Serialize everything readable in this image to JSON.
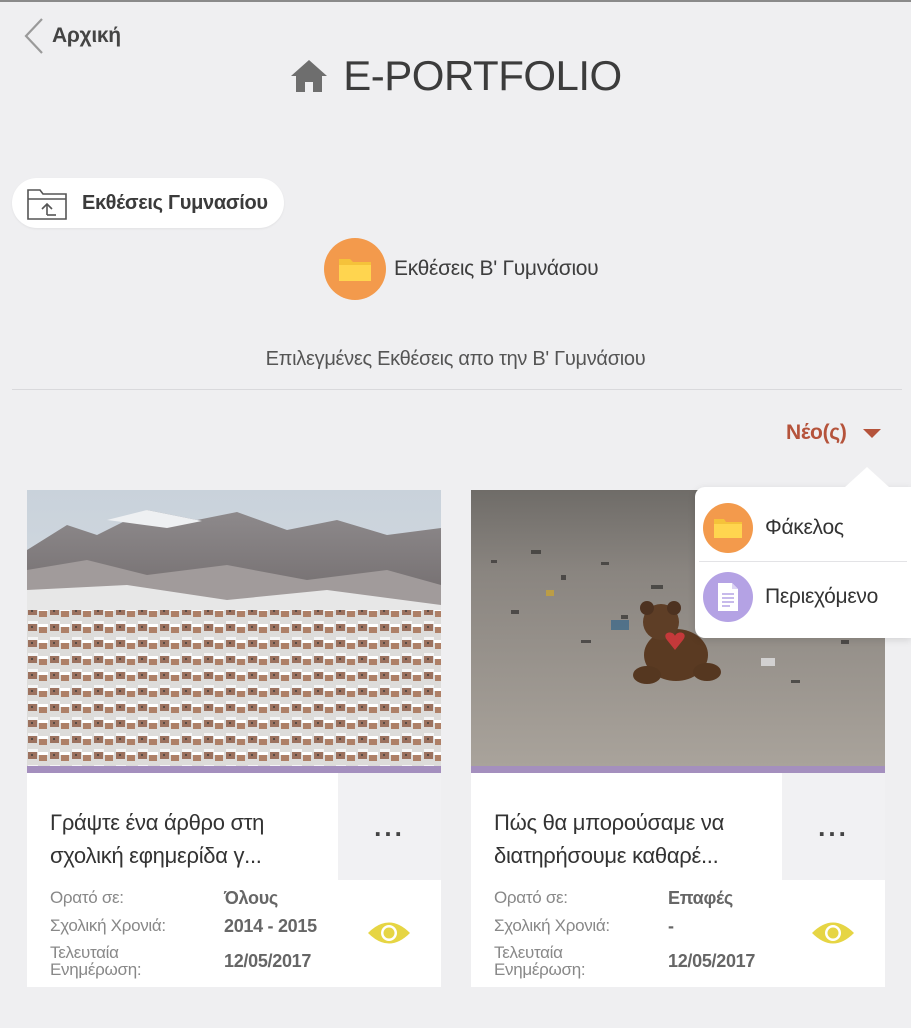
{
  "header": {
    "back_label": "Αρχική",
    "title": "E-PORTFOLIO"
  },
  "breadcrumb": {
    "parent_folder": "Εκθέσεις Γυμνασίου"
  },
  "current_folder": {
    "name": "Εκθέσεις Β' Γυμνάσιου",
    "description": "Επιλεγμένες Εκθέσεις απο την Β' Γυμνάσιου"
  },
  "new_menu": {
    "label": "Νέο(ς)",
    "items": [
      {
        "label": "Φάκελος",
        "icon": "folder-icon"
      },
      {
        "label": "Περιεχόμενο",
        "icon": "document-icon"
      }
    ]
  },
  "colors": {
    "background": "#efeff1",
    "accent": "#b5533b",
    "folder_orange": "#f39a4c",
    "content_purple": "#b4a2e4",
    "card_bar": "#a48fbe",
    "eye_yellow": "#e6d544"
  },
  "meta_labels": {
    "visible_to": "Ορατό σε:",
    "school_year": "Σχολική Χρονιά:",
    "last_updated": "Τελευταία Ενημέρωση:"
  },
  "cards": [
    {
      "title": "Γράψτε ένα άρθρο στη σχολική εφημερίδα γ...",
      "visible_to": "Όλους",
      "school_year": "2014 - 2015",
      "last_updated": "12/05/2017",
      "more_label": "...",
      "image": "snowy-village-photo"
    },
    {
      "title": "Πώς θα μπορούσαμε να διατηρήσουμε καθαρέ...",
      "visible_to": "Επαφές",
      "school_year": "-",
      "last_updated": "12/05/2017",
      "more_label": "...",
      "image": "beach-litter-teddy-photo"
    }
  ]
}
